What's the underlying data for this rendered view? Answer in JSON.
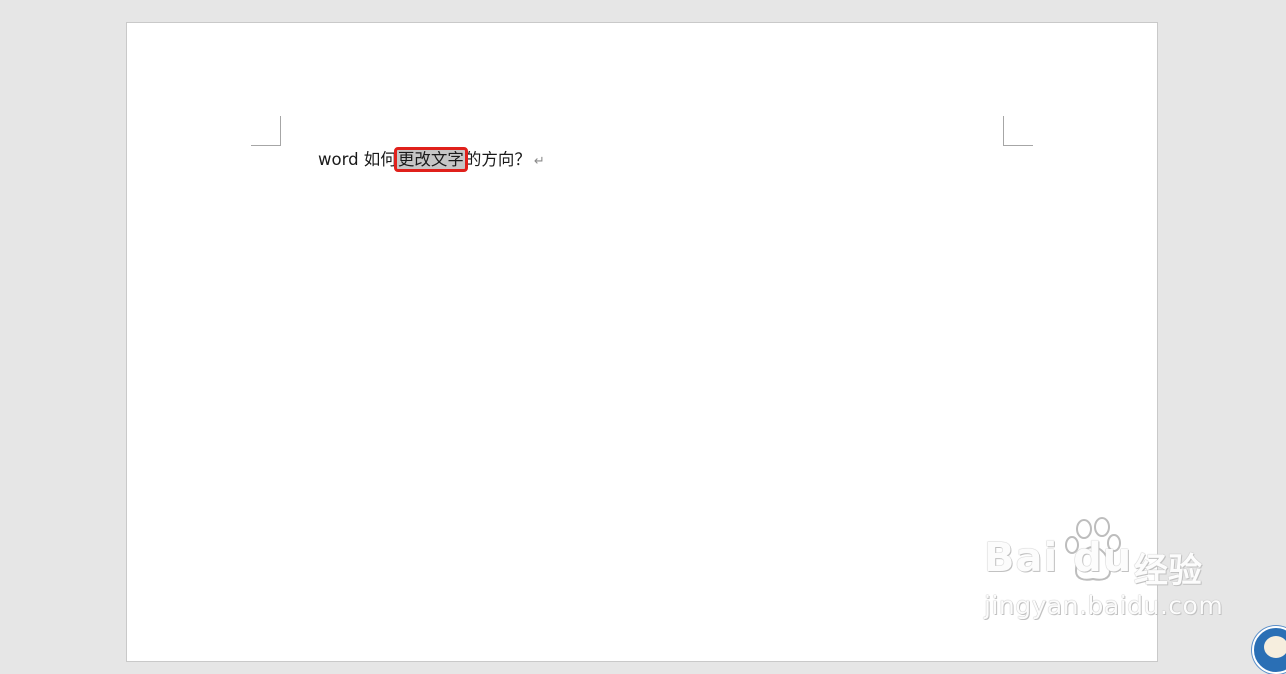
{
  "document": {
    "text_before": "word 如何",
    "selected_text": "更改文字",
    "text_after": "的方向？",
    "paragraph_mark": "↵"
  },
  "watermark": {
    "logo": "Bai du",
    "logo_cn": "经验",
    "url": "jingyan.baidu.com"
  },
  "colors": {
    "selection_outline": "#e0201b",
    "selection_fill": "#c6c6c6",
    "canvas": "#e6e6e6"
  }
}
